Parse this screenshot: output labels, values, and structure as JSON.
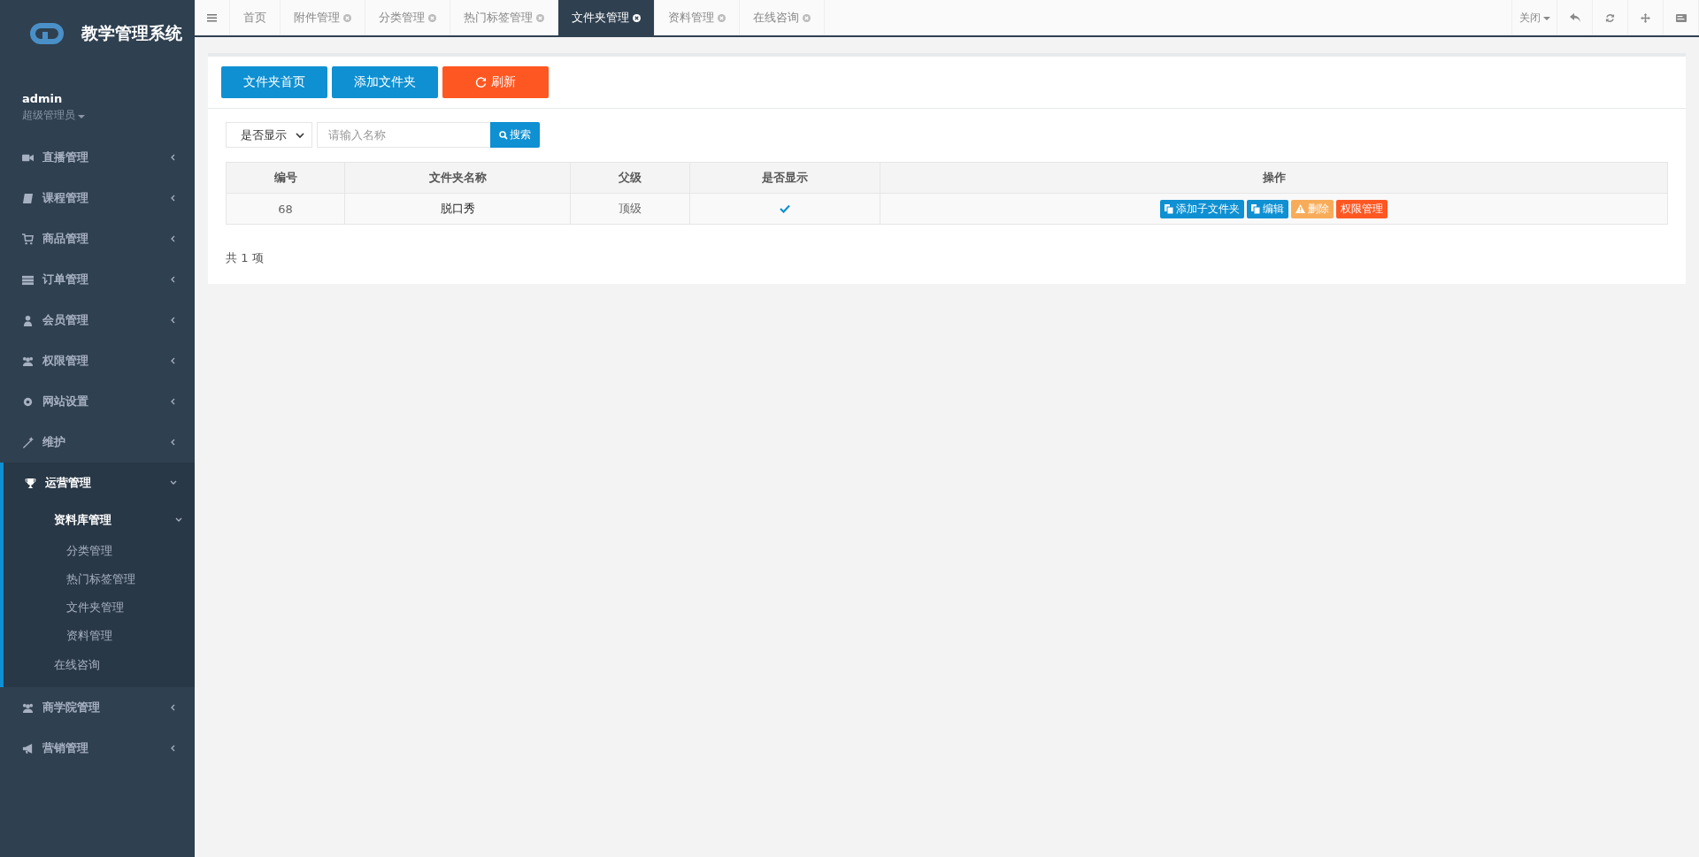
{
  "sidebar": {
    "logo_text": "教学管理系统",
    "user": {
      "name": "admin",
      "role": "超级管理员"
    },
    "items": [
      {
        "label": "直播管理",
        "kind": "video",
        "expanded": false
      },
      {
        "label": "课程管理",
        "kind": "book",
        "expanded": false
      },
      {
        "label": "商品管理",
        "kind": "cart",
        "expanded": false
      },
      {
        "label": "订单管理",
        "kind": "list",
        "expanded": false
      },
      {
        "label": "会员管理",
        "kind": "user",
        "expanded": false
      },
      {
        "label": "权限管理",
        "kind": "users",
        "expanded": false
      },
      {
        "label": "网站设置",
        "kind": "gear",
        "expanded": false
      },
      {
        "label": "维护",
        "kind": "wand",
        "expanded": false
      },
      {
        "label": "运营管理",
        "kind": "trophy",
        "expanded": true,
        "children": [
          {
            "label": "资料库管理",
            "expanded": true,
            "children": [
              {
                "label": "分类管理"
              },
              {
                "label": "热门标签管理"
              },
              {
                "label": "文件夹管理"
              },
              {
                "label": "资料管理"
              }
            ]
          },
          {
            "label": "在线咨询"
          }
        ]
      },
      {
        "label": "商学院管理",
        "kind": "users",
        "expanded": false
      },
      {
        "label": "营销管理",
        "kind": "bullhorn",
        "expanded": false
      }
    ]
  },
  "tabs": [
    {
      "label": "首页",
      "selected": false,
      "closable": false
    },
    {
      "label": "附件管理",
      "selected": false,
      "closable": true
    },
    {
      "label": "分类管理",
      "selected": false,
      "closable": true
    },
    {
      "label": "热门标签管理",
      "selected": false,
      "closable": true
    },
    {
      "label": "文件夹管理",
      "selected": true,
      "closable": true
    },
    {
      "label": "资料管理",
      "selected": false,
      "closable": true
    },
    {
      "label": "在线咨询",
      "selected": false,
      "closable": true
    }
  ],
  "tab_tools": {
    "close_menu": "关闭"
  },
  "toolbar": [
    {
      "label": "文件夹首页",
      "kind": "primary"
    },
    {
      "label": "添加文件夹",
      "kind": "primary"
    },
    {
      "label": "刷新",
      "kind": "refresh"
    }
  ],
  "filter": {
    "select": "是否显示",
    "search": {
      "placeholder": "请输入名称"
    },
    "search_button": "搜索"
  },
  "table": {
    "columns": [
      "编号",
      "文件夹名称",
      "父级",
      "是否显示",
      "操作"
    ],
    "rows": [
      {
        "id": "68",
        "name": "脱口秀",
        "parent": "顶级",
        "shown": true,
        "actions": [
          {
            "label": "添加子文件夹",
            "kind": "copy"
          },
          {
            "label": "编辑",
            "kind": "copy"
          },
          {
            "label": "删除",
            "kind": "warn"
          },
          {
            "label": "权限管理",
            "kind": "danger"
          }
        ]
      }
    ]
  },
  "total": "共 1 项"
}
